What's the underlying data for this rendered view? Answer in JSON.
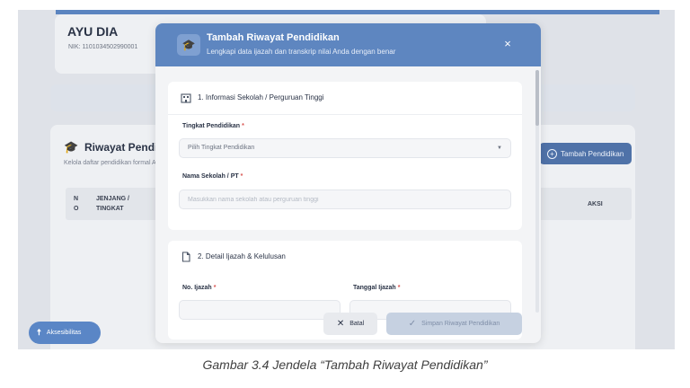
{
  "background": {
    "profile_name": "AYU DIA",
    "profile_nik": "NIK: 1101034502990001",
    "section_title": "Riwayat Pendidikan",
    "section_subtitle": "Kelola daftar pendidikan formal Anda",
    "add_button_label": "Tambah Pendidikan",
    "table_headers": [
      "N O",
      "JENJANG / TINGKAT",
      "AKSI"
    ],
    "accessibility_label": "Aksesibilitas"
  },
  "modal": {
    "title": "Tambah Riwayat Pendidikan",
    "subtitle": "Lengkapi data ijazah dan transkrip nilai Anda dengan benar",
    "close_glyph": "×",
    "section1": {
      "title": "1. Informasi Sekolah / Perguruan Tinggi",
      "level_label": "Tingkat Pendidikan",
      "level_value": "Pilih Tingkat Pendidikan",
      "school_label": "Nama Sekolah / PT",
      "school_placeholder": "Masukkan nama sekolah atau perguruan tinggi"
    },
    "section2": {
      "title": "2. Detail Ijazah & Kelulusan",
      "cert_no_label": "No. Ijazah",
      "cert_date_label": "Tanggal Ijazah"
    },
    "required_mark": "*",
    "cancel_label": "Batal",
    "save_label": "Simpan Riwayat Pendidikan"
  },
  "caption": "Gambar 3.4 Jendela “Tambah Riwayat Pendidikan”",
  "colors": {
    "header_blue": "#5e86c0",
    "primary_button": "#4f72a8",
    "required_red": "#d9534f"
  },
  "icons": {
    "header": "graduation-cap-icon",
    "section1": "building-icon",
    "section2": "document-icon",
    "cancel": "close-icon",
    "save": "check-icon"
  }
}
